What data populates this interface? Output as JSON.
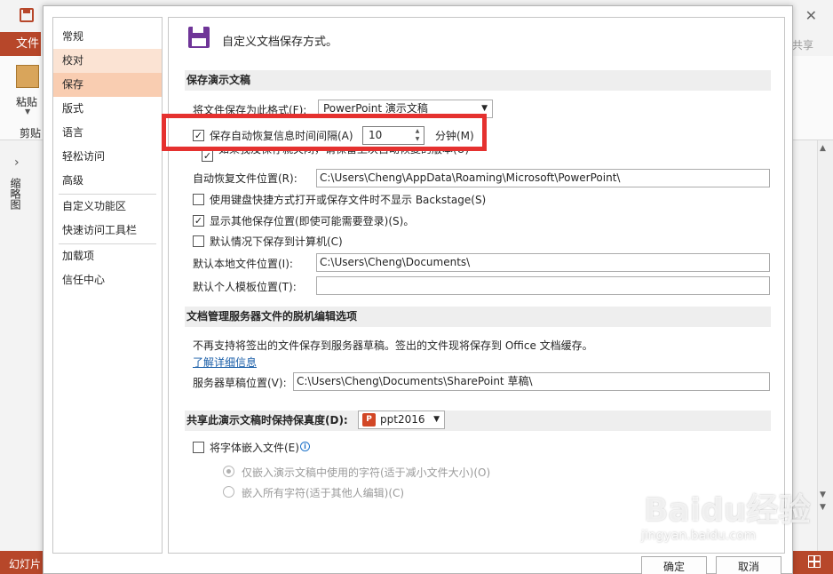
{
  "app": {
    "file_tab": "文件",
    "share": "共享",
    "paste_label": "粘贴",
    "clipboard_label": "剪贴",
    "side_panel_label": "缩略图",
    "status_left": "幻灯片"
  },
  "nav": {
    "items": [
      "常规",
      "校对",
      "保存",
      "版式",
      "语言",
      "轻松访问",
      "高级",
      "自定义功能区",
      "快速访问工具栏",
      "加载项",
      "信任中心"
    ],
    "selected": "保存"
  },
  "header": {
    "text": "自定义文档保存方式。"
  },
  "save_section": {
    "title": "保存演示文稿",
    "format_label": "将文件保存为此格式(F):",
    "format_value": "PowerPoint 演示文稿",
    "autorecover_label": "保存自动恢复信息时间间隔(A)",
    "autorecover_minutes": "10",
    "minutes_unit": "分钟(M)",
    "keep_last_label": "如果我没保存就关闭，请保留上次自动恢复的版本(U)",
    "autorecover_location_label": "自动恢复文件位置(R):",
    "autorecover_location": "C:\\Users\\Cheng\\AppData\\Roaming\\Microsoft\\PowerPoint\\",
    "no_backstage_label": "使用键盘快捷方式打开或保存文件时不显示 Backstage(S)",
    "show_more_locations_label": "显示其他保存位置(即使可能需要登录)(S)。",
    "default_to_computer_label": "默认情况下保存到计算机(C)",
    "default_local_label": "默认本地文件位置(I):",
    "default_local_value": "C:\\Users\\Cheng\\Documents\\",
    "default_template_label": "默认个人模板位置(T):",
    "default_template_value": ""
  },
  "offline_section": {
    "title": "文档管理服务器文件的脱机编辑选项",
    "notice": "不再支持将签出的文件保存到服务器草稿。签出的文件现将保存到 Office 文档缓存。",
    "learn_more": "了解详细信息",
    "drafts_label": "服务器草稿位置(V):",
    "drafts_value": "C:\\Users\\Cheng\\Documents\\SharePoint 草稿\\"
  },
  "fidelity_section": {
    "title": "共享此演示文稿时保持保真度(D):",
    "file_value": "ppt2016",
    "embed_fonts_label": "将字体嵌入文件(E)",
    "embed_used_label": "仅嵌入演示文稿中使用的字符(适于减小文件大小)(O)",
    "embed_all_label": "嵌入所有字符(适于其他人编辑)(C)"
  },
  "buttons": {
    "ok": "确定",
    "cancel": "取消"
  },
  "watermark": {
    "text": "Baidu经验",
    "sub": "jingyan.baidu.com"
  },
  "colors": {
    "accent": "#b7472a",
    "highlight": "#e5312f",
    "nav_selected": "#f9cdb1"
  }
}
